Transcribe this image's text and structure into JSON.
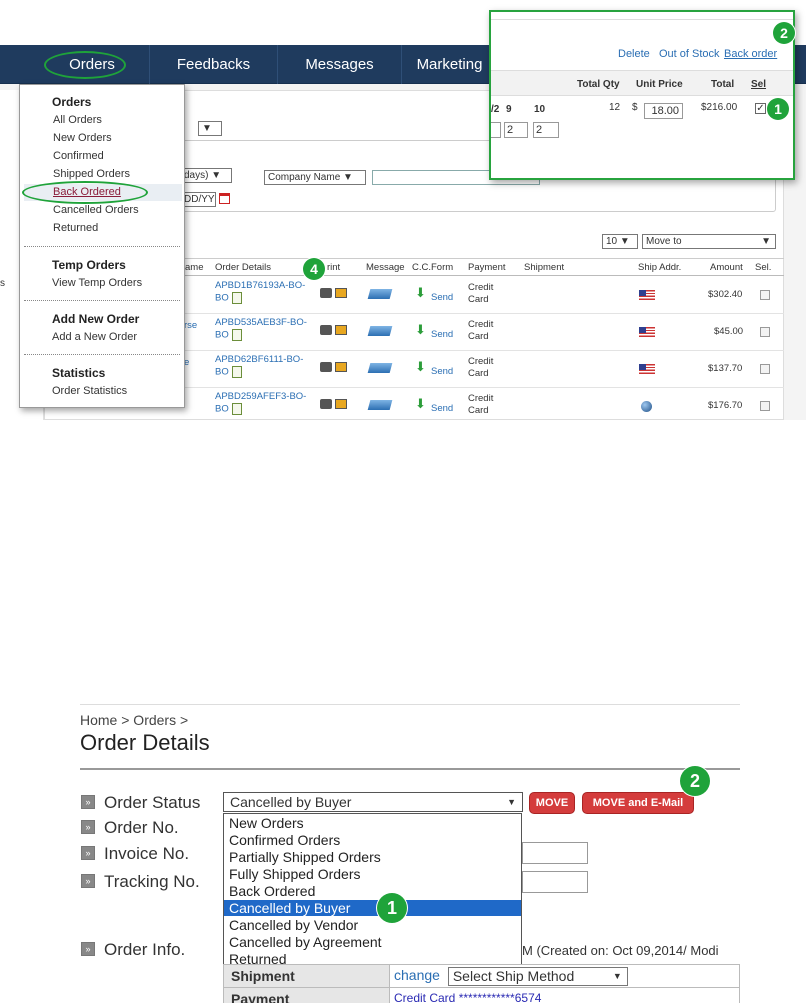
{
  "top": {
    "nav": {
      "orders": "Orders",
      "feedbacks": "Feedbacks",
      "messages": "Messages",
      "marketing": "Marketing"
    },
    "menu": {
      "orders_title": "Orders",
      "orders_items": [
        "All Orders",
        "New Orders",
        "Confirmed",
        "Shipped Orders",
        "Back Ordered",
        "Cancelled Orders",
        "Returned"
      ],
      "temp_title": "Temp Orders",
      "temp_items": [
        "View Temp Orders"
      ],
      "add_title": "Add New Order",
      "add_items": [
        "Add a New Order"
      ],
      "stats_title": "Statistics",
      "stats_items": [
        "Order Statistics"
      ]
    },
    "filters": {
      "days_select": "days)",
      "company_select": "Company Name",
      "date_placeholder": "DD/YY"
    },
    "paging": {
      "per_page": "10",
      "move_to": "Move to"
    },
    "table": {
      "headers": [
        "ame",
        "Order Details",
        "rint",
        "Message",
        "C.C.Form",
        "Payment",
        "Shipment",
        "Ship Addr.",
        "Amount",
        "Sel."
      ],
      "rows": [
        {
          "order": "APBD1B76193A-BO-BO",
          "name": "",
          "send": "Send",
          "payment": "Credit Card",
          "amount": "$302.40",
          "addr": "us"
        },
        {
          "order": "APBD535AEB3F-BO-BO",
          "name": "rse",
          "send": "Send",
          "payment": "Credit Card",
          "amount": "$45.00",
          "addr": "us"
        },
        {
          "order": "APBD62BF6111-BO-BO",
          "name": "e",
          "send": "Send",
          "payment": "Credit Card",
          "amount": "$137.70",
          "addr": "us"
        },
        {
          "order": "APBD259AFEF3-BO-BO",
          "name": "",
          "send": "Send",
          "payment": "Credit Card",
          "amount": "$176.70",
          "addr": "globe"
        }
      ],
      "left_snippet": "s"
    },
    "popup": {
      "actions": [
        "Delete",
        "Out of Stock",
        "Back order"
      ],
      "col_total_qty": "Total Qty",
      "col_unit_price": "Unit Price",
      "col_total": "Total",
      "col_sel": "Sel",
      "row_sizes": [
        "/2",
        "9",
        "10"
      ],
      "qty": "12",
      "currency": "$",
      "price": "18.00",
      "total": "$216.00",
      "inputs": [
        "2",
        "2"
      ]
    },
    "badges": {
      "one": "1",
      "two": "2",
      "four": "4"
    }
  },
  "bottom": {
    "breadcrumb": "Home > Orders >",
    "title": "Order Details",
    "labels": {
      "status": "Order Status",
      "no": "Order No.",
      "invoice": "Invoice No.",
      "tracking": "Tracking No.",
      "info": "Order Info."
    },
    "status_value": "Cancelled by Buyer",
    "move_btn": "MOVE",
    "move_email_btn": "MOVE and E-Mail",
    "options": [
      "New Orders",
      "Confirmed Orders",
      "Partially Shipped Orders",
      "Fully Shipped Orders",
      "Back Ordered",
      "Cancelled by Buyer",
      "Cancelled by Vendor",
      "Cancelled by Agreement",
      "Returned"
    ],
    "created": "M    (Created on: Oct 09,2014/ Modi",
    "shipment_label": "Shipment",
    "change_link": "change",
    "ship_method": "Select Ship Method",
    "payment_label": "Payment",
    "payment_value": "Credit Card ************6574",
    "badges": {
      "one": "1",
      "two": "2"
    }
  },
  "colors": {
    "nav_bg": "#1f3b5e",
    "highlight_green": "#1fa33a",
    "selected_blue": "#1f69c8",
    "button_red": "#d43c3c"
  }
}
